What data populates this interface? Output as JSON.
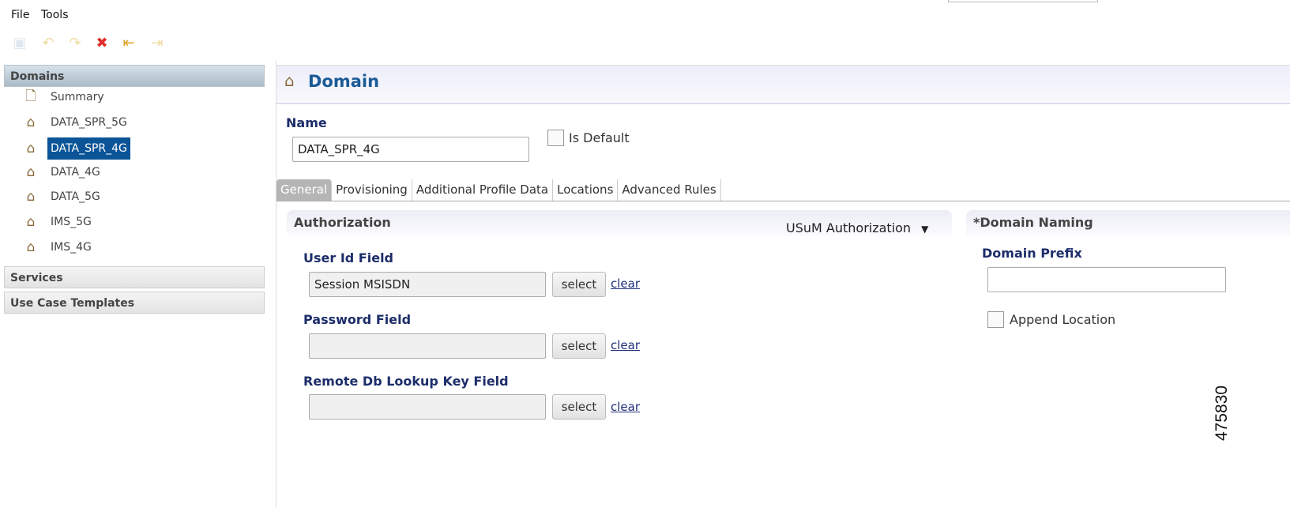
{
  "menu": [
    "File",
    "Tools"
  ],
  "toolbar": [
    {
      "icon": "save-icon",
      "glyph": "💾"
    },
    {
      "icon": "undo-icon",
      "glyph": "↶"
    },
    {
      "icon": "redo-icon",
      "glyph": "↷"
    },
    {
      "icon": "delete-icon",
      "glyph": "✖"
    },
    {
      "icon": "move-first-icon",
      "glyph": "⇤"
    },
    {
      "icon": "move-last-icon",
      "glyph": "⇥"
    }
  ],
  "sidebar": {
    "domains_header": "Domains",
    "items": [
      "Summary",
      "DATA_SPR_5G",
      "DATA_SPR_4G",
      "DATA_4G",
      "DATA_5G",
      "IMS_5G",
      "IMS_4G"
    ],
    "selected": "DATA_SPR_4G",
    "services_header": "Services",
    "use_case_header": "Use Case Templates"
  },
  "main": {
    "title": "Domain",
    "name_label": "Name",
    "name_value": "DATA_SPR_4G",
    "is_default_label": "Is Default",
    "tabs": [
      "General",
      "Provisioning",
      "Additional Profile Data",
      "Locations",
      "Advanced Rules"
    ],
    "authorization": {
      "title": "Authorization",
      "dropdown": "USuM Authorization",
      "fields": [
        {
          "label": "User Id Field",
          "value": "Session MSISDN"
        },
        {
          "label": "Password Field",
          "value": ""
        },
        {
          "label": "Remote Db Lookup Key Field",
          "value": ""
        }
      ],
      "select_label": "select",
      "clear_label": "clear"
    },
    "naming": {
      "title": "*Domain Naming",
      "prefix_label": "Domain Prefix",
      "prefix_value": "",
      "append_label": "Append Location"
    }
  },
  "figure_id": "475830",
  "colors": {
    "accent": "#0b5497",
    "title": "#1a5a96",
    "label": "#1d2d6a"
  }
}
